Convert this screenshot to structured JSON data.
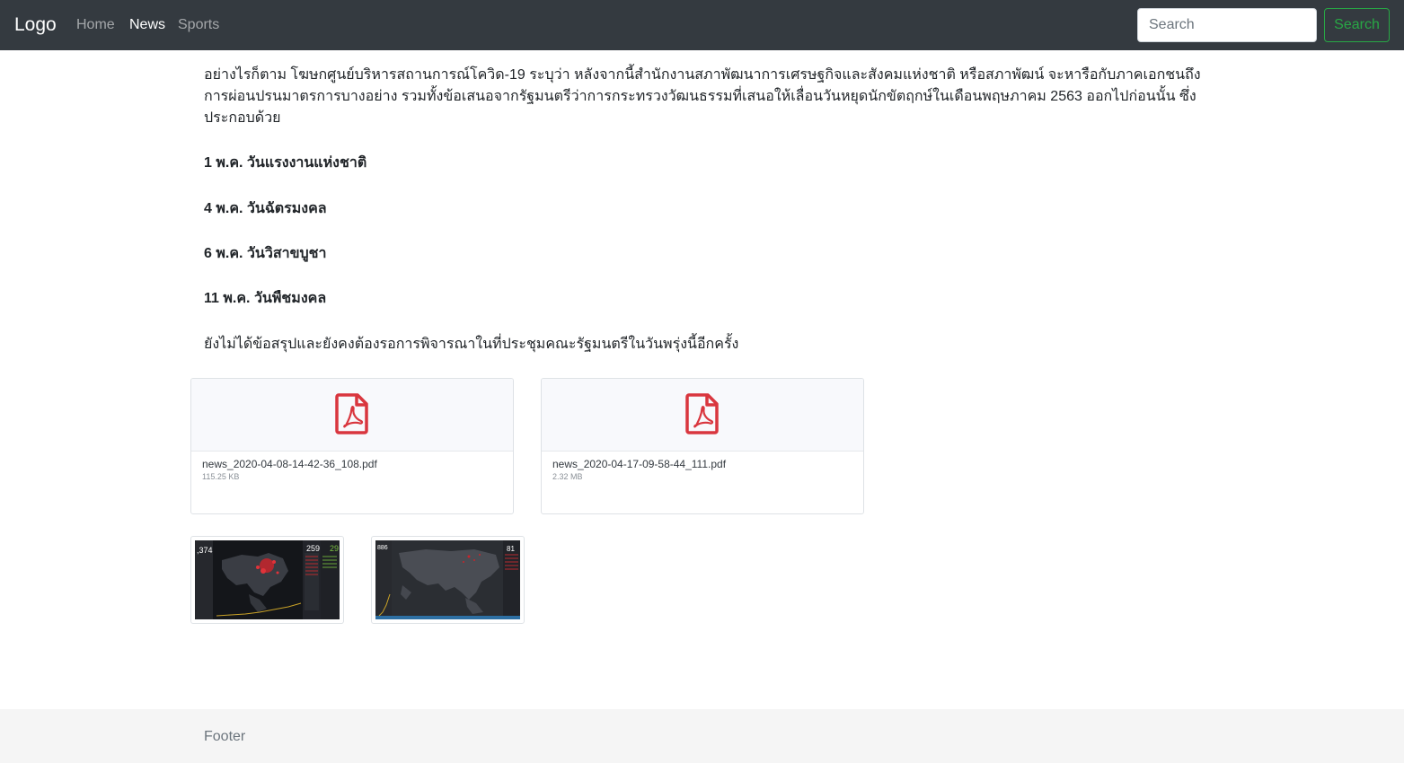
{
  "navbar": {
    "brand": "Logo",
    "links": [
      {
        "label": "Home",
        "active": false
      },
      {
        "label": "News",
        "active": true
      },
      {
        "label": "Sports",
        "active": false
      }
    ],
    "search": {
      "placeholder": "Search",
      "value": "",
      "button_label": "Search"
    },
    "colors": {
      "background": "#343a40",
      "button": "#28a745"
    }
  },
  "article": {
    "intro": "อย่างไรก็ตาม โฆษกศูนย์บริหารสถานการณ์โควิด-19 ระบุว่า หลังจากนี้สำนักงานสภาพัฒนาการเศรษฐกิจและสังคมแห่งชาติ หรือสภาพัฒน์ จะหารือกับภาคเอกชนถึงการผ่อนปรนมาตรการบางอย่าง รวมทั้งข้อเสนอจากรัฐมนตรีว่าการกระทรวงวัฒนธรรมที่เสนอให้เลื่อนวันหยุดนักขัตฤกษ์ในเดือนพฤษภาคม 2563 ออกไปก่อนนั้น ซึ่งประกอบด้วย",
    "holidays": [
      "1 พ.ค. วันแรงงานแห่งชาติ",
      "4 พ.ค. วันฉัตรมงคล",
      "6 พ.ค. วันวิสาขบูชา",
      "11 พ.ค. วันพืชมงคล"
    ],
    "closing": "ยังไม่ได้ข้อสรุปและยังคงต้องรอการพิจารณาในที่ประชุมคณะรัฐมนตรีในวันพรุ่งนี้อีกครั้ง"
  },
  "attachments": [
    {
      "name": "news_2020-04-08-14-42-36_108.pdf",
      "size": "115.25 KB",
      "icon": "pdf-icon"
    },
    {
      "name": "news_2020-04-17-09-58-44_111.pdf",
      "size": "2.32 MB",
      "icon": "pdf-icon"
    }
  ],
  "images": [
    {
      "label_left": ",374",
      "label_mid": "259",
      "label_right": "29"
    },
    {
      "label_left": "886",
      "label_mid": "",
      "label_right": "81"
    }
  ],
  "footer": {
    "text": "Footer"
  }
}
